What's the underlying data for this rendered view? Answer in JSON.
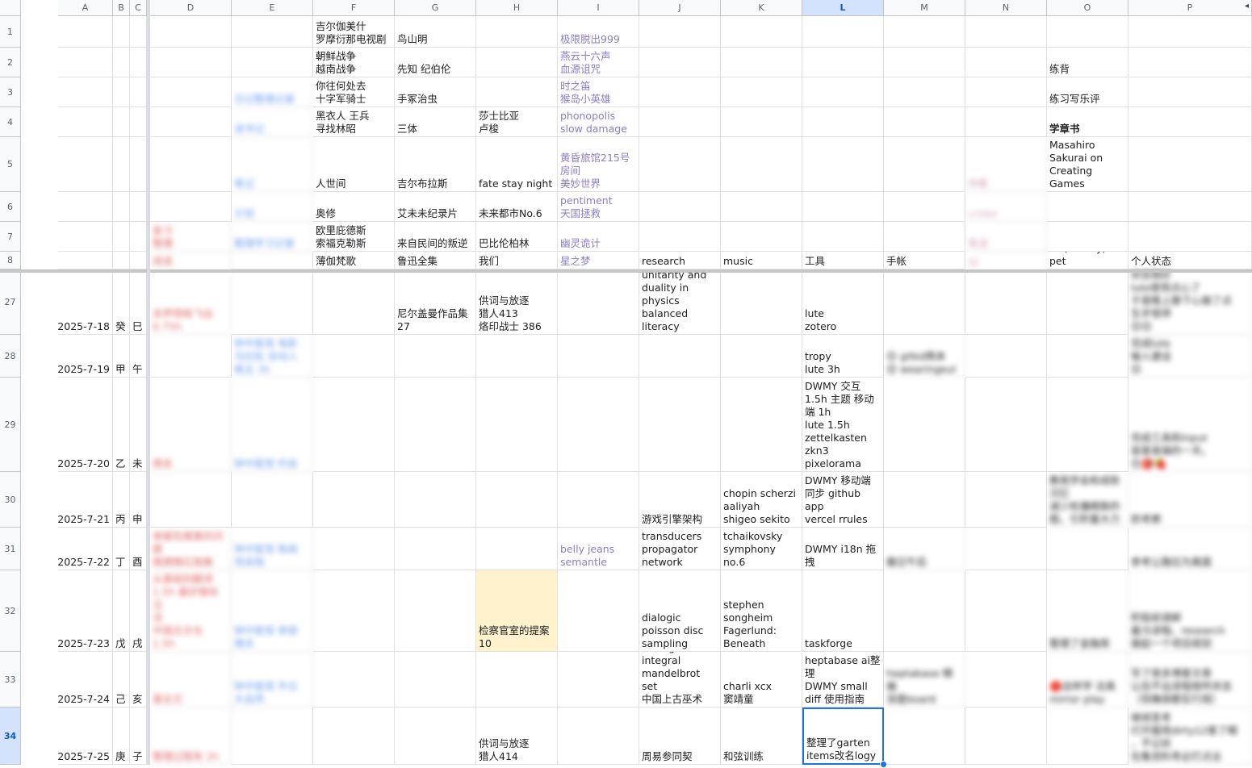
{
  "sheet": {
    "columns": [
      {
        "name": "col-a",
        "label": "A"
      },
      {
        "name": "col-b",
        "label": "B"
      },
      {
        "name": "col-c",
        "label": "C"
      },
      {
        "name": "col-d",
        "label": "D"
      },
      {
        "name": "col-e",
        "label": "E"
      },
      {
        "name": "col-f",
        "label": "F"
      },
      {
        "name": "col-g",
        "label": "G"
      },
      {
        "name": "col-h",
        "label": "H"
      },
      {
        "name": "col-i",
        "label": "I"
      },
      {
        "name": "col-j",
        "label": "J"
      },
      {
        "name": "col-k",
        "label": "K"
      },
      {
        "name": "col-l",
        "label": "L",
        "selected": true
      },
      {
        "name": "col-m",
        "label": "M"
      },
      {
        "name": "col-n",
        "label": "N"
      },
      {
        "name": "col-o",
        "label": "O"
      },
      {
        "name": "col-p",
        "label": "P"
      }
    ],
    "active_cell": "L34",
    "scroll_arrow_label": "◂",
    "colors": {
      "accent": "#1a73e8",
      "highlight": "#fff2cc",
      "purple_text": "#8e7cc3",
      "red_text": "#e06666",
      "blue_text": "#6d9eeb"
    },
    "rows": [
      {
        "num": "1",
        "cells": {
          "F": "吉尔伽美什\n罗摩衍那电视剧",
          "G": "鸟山明",
          "I": {
            "t": "极限脱出999",
            "s": "purple"
          }
        }
      },
      {
        "num": "2",
        "cells": {
          "F": "朝鲜战争\n越南战争",
          "G": "先知 纪伯伦",
          "I": {
            "t": "燕云十六声\n血源诅咒",
            "s": "purple"
          },
          "O": "练背"
        }
      },
      {
        "num": "3",
        "cells": {
          "E": {
            "t": "日记整理记录",
            "s": "blue blur"
          },
          "F": "你往何处去\n十字军骑士",
          "G": "手冢治虫",
          "I": {
            "t": "时之笛\n猴岛小英雄",
            "s": "purple"
          },
          "O": "练习写乐评"
        }
      },
      {
        "num": "4",
        "cells": {
          "E": {
            "t": "读书记",
            "s": "blue blur"
          },
          "F": "黑衣人 王兵\n寻找林昭",
          "G": "三体",
          "H": "莎士比亚\n卢梭",
          "I": {
            "t": "phonopolis\nslow damage",
            "s": "purple"
          },
          "O": {
            "t": "学章书",
            "s": "bold"
          }
        }
      },
      {
        "num": "5",
        "cells": {
          "E": {
            "t": "笔记",
            "s": "blue blur"
          },
          "F": "人世间",
          "G": "吉尔布拉斯",
          "H": "fate stay night",
          "I": {
            "t": "黄昏旅馆215号\n房间\n美妙世界",
            "s": "purple"
          },
          "N": {
            "t": "待看",
            "s": "pink blur"
          },
          "O": "Masahiro\nSakurai on\nCreating\nGames"
        }
      },
      {
        "num": "6",
        "cells": {
          "E": {
            "t": "计划",
            "s": "blue blur"
          },
          "F": "奥修",
          "G": "艾未未纪录片",
          "H": "未来都市No.6",
          "I": {
            "t": "pentiment\n天国拯救",
            "s": "purple"
          },
          "N": {
            "t": "criske",
            "s": "pink blur"
          }
        }
      },
      {
        "num": "7",
        "cells": {
          "D": {
            "t": "复习\n整理",
            "s": "red blur"
          },
          "E": {
            "t": "整理学习记录",
            "s": "blue blur"
          },
          "F": "欧里庇德斯\n索福克勒斯",
          "G": "来自民间的叛逆",
          "H": "巴比伦柏林",
          "I": {
            "t": "幽灵诡计",
            "s": "purple"
          },
          "N": {
            "t": "笔迹",
            "s": "pink blur"
          }
        }
      },
      {
        "num": "8",
        "cells": {
          "D": {
            "t": "阅读",
            "s": "red blur"
          },
          "F": "薄伽梵歌",
          "G": "鲁迅全集",
          "H": "我们",
          "I": {
            "t": "星之梦",
            "s": "purple"
          },
          "J": "research",
          "K": "music",
          "L": "工具",
          "M": "手帐",
          "N": {
            "t": "rp",
            "s": "pink blur"
          },
          "O": "life, family, pet",
          "P": "个人状态"
        }
      },
      {
        "num": "27",
        "cells": {
          "A": "2025-7-18",
          "B": "癸",
          "C": "巳",
          "D": {
            "t": "去伊塔帕飞出\n0.75h",
            "s": "red blur"
          },
          "G": "尼尔盖曼作品集\n27",
          "H": "供词与放逐\n猎人413\n烙印战士 386",
          "J": "unitarity and\nduality in\nphysics\nbalanced\nliteracy",
          "L": "lute\nzotero",
          "P": {
            "t": "状态很好\nlute使用点心了\n于是晚上静下心做了点\n生岁很停\n😊😊",
            "s": "blur"
          }
        }
      },
      {
        "num": "28",
        "cells": {
          "A": "2025-7-19",
          "B": "甲",
          "C": "午",
          "E": {
            "t": "钟中医馆 电影\n马拉松 自动人\n格主 3h",
            "s": "blue blur"
          },
          "L": "tropy\nlute 3h",
          "M": {
            "t": "😊 gitkd两本\n😊 wearingeul",
            "s": "blur"
          },
          "P": {
            "t": "完成lute\n输入建设\n😊",
            "s": "blur"
          }
        }
      },
      {
        "num": "29",
        "cells": {
          "A": "2025-7-20",
          "B": "乙",
          "C": "未",
          "D": {
            "t": "两余",
            "s": "red blur"
          },
          "E": {
            "t": "钟中医馆 约会",
            "s": "blue blur"
          },
          "L": "DWMY 交互\n1.5h 主题 移动\n端 1h\nlute 1.5h\nzettelkasten\nzkn3\npixelorama",
          "P": {
            "t": "完成工具和input\n容喜易操的一天。\n😊🎒🍓",
            "s": "blur"
          }
        }
      },
      {
        "num": "30",
        "cells": {
          "A": "2025-7-21",
          "B": "丙",
          "C": "申",
          "J": "游戏引擎架构",
          "K": "chopin scherzi\naaliyah\nshigeo sekito",
          "L": "DWMY 移动端\n同步 github app\nvercel rrules",
          "O": {
            "t": "教我学会和成败\n沉忆\n减少轮播精致的\n图，引积重大力",
            "s": "blur"
          },
          "P": {
            "t": "抓考察",
            "s": "blur"
          }
        }
      },
      {
        "num": "31",
        "cells": {
          "A": "2025-7-22",
          "B": "丁",
          "C": "酉",
          "D": {
            "t": "单据包推推的问\n题\n推拥推红抱推",
            "s": "red blur"
          },
          "E": {
            "t": "钟中医馆 购商\n场采购",
            "s": "blue blur"
          },
          "I": {
            "t": "belly jeans\nsemantle",
            "s": "purple"
          },
          "J": "transducers\npropagator\nnetwork",
          "K": "tchaikovsky\nsymphony no.6",
          "L": "DWMY i18n 拖\n拽",
          "M": {
            "t": "搬日午后",
            "s": "blur"
          },
          "P": {
            "t": "参考让路拉为离面",
            "s": "blur"
          }
        }
      },
      {
        "num": "32",
        "cells": {
          "A": "2025-7-23",
          "B": "戊",
          "C": "戌",
          "D": {
            "t": "整理zotero 2h\n从基础别翻译\n1.5h 最好做标注\n活\n中国古文化\n1.5h",
            "s": "red blur"
          },
          "E": {
            "t": "钟中医馆 参部\n情关",
            "s": "blue blur"
          },
          "H": {
            "t": "检察官室的提案\n10",
            "s": "hl"
          },
          "J": "dialogic\npoisson disc\nsampling",
          "K": "stephen\nsongheim\nFagerlund:\nBeneath",
          "L": "taskforge",
          "O": {
            "t": "整理了金融库",
            "s": "blur"
          },
          "P": {
            "t": "积极前调邮\n最冷进程。research\n做起一个项目规划\n",
            "s": "blur"
          }
        }
      },
      {
        "num": "33",
        "cells": {
          "A": "2025-7-24",
          "B": "己",
          "C": "亥",
          "D": {
            "t": "喜论文",
            "s": "red blur"
          },
          "E": {
            "t": "钟中医馆 外位\n大自然",
            "s": "blue blur"
          },
          "J": "lebesgue\nintegral\nmandelbrot set\n中国上古巫术",
          "K": "charli xcx\n窦靖童",
          "L": "heptabase ai整\n理\nDWMY small\ndiff 使用指南",
          "M": {
            "t": "heptabase 精编\n深度board",
            "s": "blur"
          },
          "O": {
            "t": "🔴这样学 法真\nmirror play",
            "s": "blur"
          },
          "P": {
            "t": "写了很多博客文章\n让后不出进程按所状态\n（但确保都实行规）",
            "s": "blur"
          }
        }
      },
      {
        "num": "34",
        "cells": {
          "A": "2025-7-25",
          "B": "庚",
          "C": "子",
          "D": {
            "t": "整理过程有 2h",
            "s": "red blur"
          },
          "H": "供词与放逐\n猎人414",
          "J": "周易参同契",
          "K": "和弦训练",
          "L": {
            "t": "整理了garten\nitems改名logy",
            "s": "active"
          },
          "P": {
            "t": "继续答考\n打开服用dirty12客了眼\n，不记状\n在集资料考必打点业",
            "s": "blur"
          }
        }
      }
    ]
  }
}
